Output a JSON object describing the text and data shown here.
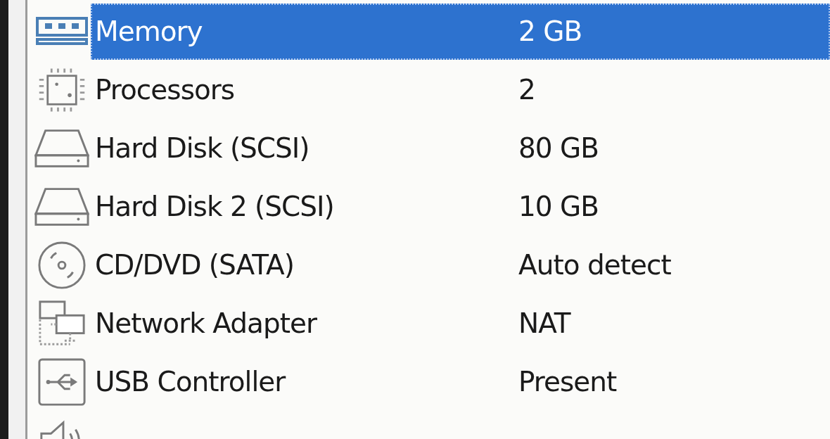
{
  "devices": [
    {
      "kind": "memory",
      "name": "Memory",
      "value": "2 GB",
      "selected": true
    },
    {
      "kind": "processor",
      "name": "Processors",
      "value": "2",
      "selected": false
    },
    {
      "kind": "disk",
      "name": "Hard Disk (SCSI)",
      "value": "80 GB",
      "selected": false
    },
    {
      "kind": "disk",
      "name": "Hard Disk 2 (SCSI)",
      "value": "10 GB",
      "selected": false
    },
    {
      "kind": "cd",
      "name": "CD/DVD (SATA)",
      "value": "Auto detect",
      "selected": false
    },
    {
      "kind": "network",
      "name": "Network Adapter",
      "value": "NAT",
      "selected": false
    },
    {
      "kind": "usb",
      "name": "USB Controller",
      "value": "Present",
      "selected": false
    },
    {
      "kind": "sound",
      "selected": false
    }
  ]
}
